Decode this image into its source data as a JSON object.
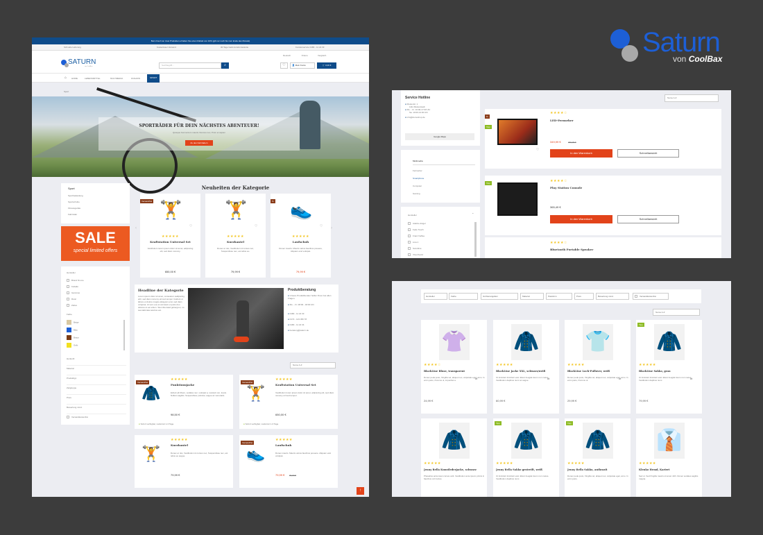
{
  "logo": {
    "word": "Saturn",
    "byline_prefix": "von",
    "byline_brand": "CoolBax"
  },
  "colors": {
    "blue": "#1d5fa3",
    "dark_blue": "#0f4c8a",
    "accent": "#e2431a",
    "star": "#f3c623",
    "tag_brown": "#8a3c1a",
    "tag_green": "#8dbb24"
  },
  "p1": {
    "topbar": "Beim Kauf von zwei Produkten erhalten Sie einen Rabatt von 10% (gilt nur noch bis zum Ende des Monats)",
    "usps": [
      "Schnelle Lieferung",
      "Kostenloser Versand",
      "30 Tage Geld-zurück-Garantie",
      "Kundenservice 0180 - 11 22 33"
    ],
    "lang": "Deutsch",
    "currency": "€ Euro",
    "compare": "Vergleich",
    "store_name": "SATURN",
    "store_tag": "von CoolBax",
    "search_placeholder": "Suchbegriff...",
    "account": "Mein Konto",
    "cart_total": "0,00 €",
    "nav": [
      "HOME",
      "LEBENSMITTEL",
      "MULTIMEDIA",
      "FASHION",
      "SPORT"
    ],
    "breadcrumb": "Sport",
    "hero_title": "SPORTRÄDER FÜR DEIN NÄCHSTES ABENTEUER!",
    "hero_text": "Quisque Fermentum mauris rhoncus nec, Proin et sapien",
    "hero_btn": "Zu den Fahrrädern",
    "cat_title": "Sport",
    "cat_items": [
      "Sportbekleidung",
      "Sportschuhe",
      "Fitnessgeräte",
      "Fahrräder"
    ],
    "sale": "SALE",
    "sale_sub": "special limited offers",
    "filter_hersteller": "Hersteller",
    "brands": [
      "Brand Nr.one",
      "Kuballo",
      "Gammax",
      "Rival",
      "Zeltex"
    ],
    "filter_farbe": "Farbe",
    "colors_list": [
      {
        "name": "Beige",
        "hex": "#d9c9a3"
      },
      {
        "name": "Blau",
        "hex": "#1d5fd6"
      },
      {
        "name": "Braun",
        "hex": "#7a3c16"
      },
      {
        "name": "Gelb",
        "hex": "#f2e020"
      }
    ],
    "filter_more": [
      "Herkunft",
      "Material",
      "Produkttyp",
      "Zielgruppe",
      "Preis",
      "Bewertung mind."
    ],
    "filter_stock": "Versandkostenfrei",
    "new_title": "Neuheiten der Kategorie",
    "new_products": [
      {
        "name": "Kraftstation Universal Set",
        "price": "650,00 €",
        "old": "",
        "tag": "Versandfrei",
        "icon": "🏋",
        "text": "Vestibulum lorem ipsum dolor sit amet, adipiscing elit, sed diam nonumy."
      },
      {
        "name": "Kurzhantel",
        "price": "79,99 €",
        "old": "",
        "tag": "",
        "icon": "🏋",
        "text": "Donec et nisi, Vestibulum id cursus nec, Suspendisse nec, est tellus eu."
      },
      {
        "name": "Laufschuh",
        "price": "79,99 €",
        "old": "99,99 €",
        "tag": "%",
        "icon": "👟",
        "text": "Donec mauris. Mauris varius faucibus posuere, Aliquam erat volutpat."
      }
    ],
    "headline_title": "Headline der Kategorie",
    "headline_text": "Lorem ipsum dolor sit amet, consetetur sadipscing elitr, sed diam nonumy eirmod tempor invidunt ut labore et dolore magna aliquyam erat, sed diam voluptua. At vero eos et accusam et justo duo dolores et ea rebum. Stet clita kasd gubergren, no sea takimata sanctus est.",
    "advice_title": "Produktberatung",
    "advice_lines": [
      "Unsere Produktberater helfen Ihnen bei allen Fragen.",
      "Mo. - Fr. 08:00 - 18:00 Uhr",
      "0180 - 11 22 33",
      "0172 - 123 456 78",
      "0180 - 11 22 34",
      "beratung@saturn.de"
    ],
    "sort": "Name A-Z",
    "list_products": [
      {
        "name": "Funktionsjacke",
        "price": "98,50 €",
        "old": "",
        "tag": "Versandfrei",
        "icon": "🧥",
        "text": "Exbeti elit libero, sodales nec, volutpat a, suscipit non, turpis. Nullam sagittis. Suspendisse pulvinar, augue ac venenatis."
      },
      {
        "name": "Kraftstation Universal Set",
        "price": "650,00 €",
        "old": "",
        "tag": "Versandfrei",
        "icon": "🏋",
        "text": "Vestibulum lorem ipsum dolor sit amet, adipiscing elit, sed diam nonumy eirmod tempor."
      },
      {
        "name": "Kurzhantel",
        "price": "79,99 €",
        "old": "",
        "tag": "",
        "icon": "🏋",
        "text": "Donec et nisi, Vestibulum id cursus nec, Suspendisse nec, est tellus eu augue."
      },
      {
        "name": "Laufschuh",
        "price": "79,99 €",
        "old": "99,99 €",
        "tag": "Versandfrei",
        "icon": "👟",
        "text": "Donec mauris. Mauris varius faucibus posuere. Aliquam erat volutpat."
      }
    ],
    "stock_note": "Sofort verfügbar, Lieferzeit 1-3 Tage"
  },
  "p2": {
    "hotline_title": "Service Hotline",
    "hotline_lines": [
      "Musterstr. 1",
      "1111 Musterstadt",
      "Mo. - Fr. 10:00-17:00 Uhr",
      "Sa. 10:00-14:00 Uhr",
      "info@demoshop.de"
    ],
    "maps": "Google Maps",
    "mm_title": "Multimedia",
    "mm_items": [
      "Fernseher",
      "Smartphone",
      "Computer",
      "Gaming"
    ],
    "brand_title": "Hersteller",
    "brands": [
      "Adeline Engel",
      "Fede Touch",
      "Franz Kaffee",
      "Lina 1",
      "Sunshine",
      "Viva Zvezd"
    ],
    "sort": "Name A-Z",
    "products": [
      {
        "name": "LED-Fernseher",
        "price": "349,99 €",
        "old": "399,99 €",
        "tag": "Tipp",
        "icon": "📺"
      },
      {
        "name": "Play Station Console",
        "price": "365,49 €",
        "old": "",
        "tag": "Tipp",
        "icon": "🎮"
      },
      {
        "name": "Bluetooth Portable Speaker",
        "price": "",
        "old": "",
        "tag": "",
        "icon": ""
      }
    ],
    "cart_btn": "In den Warenkorb",
    "quick_btn": "Schnellansicht"
  },
  "p3": {
    "filters": [
      "Hersteller",
      "Farbe",
      "Größenangaben",
      "Material",
      "Passform",
      "Preis",
      "Bewertung mind.",
      "Versandkostenfrei"
    ],
    "sort": "Name A-Z",
    "products": [
      {
        "name": "BlackLine Bluse, transparent",
        "price": "24,99 €",
        "tag": "",
        "icon": "👚",
        "text": "Donec pede justo, fringilla vel, aliquet nec, vulputate eget, arcu. In enim justo, rhoncus ut, imperdiet a."
      },
      {
        "name": "BlackLine Jacke XXL, schwarz/weiß",
        "price": "60,99 €",
        "tag": "",
        "icon": "🧥",
        "text": "Ut tincidunt tincidunt erat. Etiam feugiat lorem non metus. Vestibulum dapibus nunc ac augue."
      },
      {
        "name": "BlackLine Loch-Pullover, weiß",
        "price": "29,99 €",
        "tag": "",
        "icon": "👕",
        "text": "Donec pede justo, fringilla vel, aliquet nec, vulputate eget, arcu. In enim justo, rhoncus ut."
      },
      {
        "name": "BlackLine Sakko, grau",
        "price": "79,99 €",
        "tag": "Tipp",
        "icon": "🧥",
        "text": "Ut tincidunt tincidunt erat. Etiam feugiat lorem non metus. Vestibulum dapibus nunc."
      },
      {
        "name": "Jenny Bella Kunstlederjacke, schwarz",
        "price": "",
        "tag": "",
        "icon": "🧥",
        "text": "Phasellus accumsan cursus velit. Vestibulum ante ipsum primis in faucibus orci luctus."
      },
      {
        "name": "Jenny Bella Sakko gestreift, weiß",
        "price": "",
        "tag": "Tipp",
        "icon": "🧥",
        "text": "Ut tincidunt tincidunt erat. Etiam feugiat lorem non metus. Vestibulum dapibus nunc."
      },
      {
        "name": "Jenny Bella Sakko, anthrazit",
        "price": "",
        "tag": "Tipp",
        "icon": "🧥",
        "text": "Donec pede justo, fringilla vel, aliquet nec, vulputate eget, arcu. In enim justo."
      },
      {
        "name": "Klenko Hemd, Kariert",
        "price": "",
        "tag": "",
        "icon": "👔",
        "text": "Sed ut. Sed fringilla mauris sit amet nibh. Donec sodales sagittis magna."
      }
    ]
  }
}
